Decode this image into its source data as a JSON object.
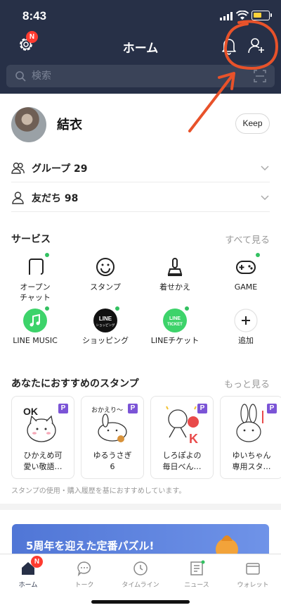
{
  "status_bar": {
    "time": "8:43"
  },
  "header": {
    "title": "ホーム",
    "settings_badge": "N",
    "search_placeholder": "検索"
  },
  "profile": {
    "name": "結衣",
    "keep_label": "Keep"
  },
  "groups": {
    "label": "グループ 29"
  },
  "friends": {
    "label": "友だち 98"
  },
  "services": {
    "title": "サービス",
    "see_all": "すべて見る",
    "items": [
      {
        "label_line1": "オープン",
        "label_line2": "チャット",
        "icon": "open-chat-icon"
      },
      {
        "label_line1": "スタンプ",
        "label_line2": "",
        "icon": "smiley-icon"
      },
      {
        "label_line1": "着せかえ",
        "label_line2": "",
        "icon": "brush-icon"
      },
      {
        "label_line1": "GAME",
        "label_line2": "",
        "icon": "gamepad-icon"
      },
      {
        "label_line1": "LINE MUSIC",
        "label_line2": "",
        "icon": "music-icon"
      },
      {
        "label_line1": "ショッピング",
        "label_line2": "",
        "icon": "line-shopping-icon",
        "logo_text_1": "LINE",
        "logo_text_2": "ショッピング"
      },
      {
        "label_line1": "LINEチケット",
        "label_line2": "",
        "icon": "line-ticket-icon",
        "logo_text_1": "LINE",
        "logo_text_2": "TICKET"
      },
      {
        "label_line1": "追加",
        "label_line2": "",
        "icon": "plus-icon"
      }
    ]
  },
  "stickers": {
    "title": "あなたにおすすめのスタンプ",
    "more": "もっと見る",
    "items": [
      {
        "line1": "ひかえめ可",
        "line2": "愛い敬語…",
        "premium": "P"
      },
      {
        "line1": "ゆるうさぎ",
        "line2": "6",
        "premium": "P"
      },
      {
        "line1": "しろぽよの",
        "line2": "毎日べん…",
        "premium": "P"
      },
      {
        "line1": "ゆいちゃん",
        "line2": "専用スタ…",
        "premium": "P"
      }
    ],
    "note": "スタンプの使用・購入履歴を基におすすめしています。"
  },
  "banner": {
    "text": "5周年を迎えた定番パズル!"
  },
  "tabs": [
    {
      "label": "ホーム",
      "icon": "home-icon",
      "active": true,
      "badge": "N"
    },
    {
      "label": "トーク",
      "icon": "chat-icon",
      "active": false
    },
    {
      "label": "タイムライン",
      "icon": "clock-icon",
      "active": false
    },
    {
      "label": "ニュース",
      "icon": "news-icon",
      "active": false
    },
    {
      "label": "ウォレット",
      "icon": "wallet-icon",
      "active": false
    }
  ],
  "colors": {
    "header_bg": "#273047",
    "accent_green": "#33c161",
    "badge_red": "#ff3b30",
    "premium_purple": "#7b54d6",
    "annotation_red": "#e8522a"
  }
}
